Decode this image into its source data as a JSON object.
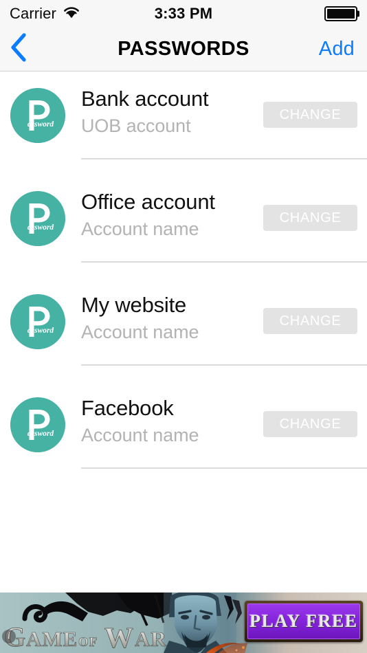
{
  "status_bar": {
    "carrier": "Carrier",
    "wifi_icon": "wifi-icon",
    "time": "3:33 PM",
    "battery_icon": "battery-full-icon"
  },
  "nav_bar": {
    "back_icon": "chevron-left-icon",
    "title": "PASSWORDS",
    "add_label": "Add",
    "accent_color": "#0a7cff",
    "background_color": "#f7f7f7"
  },
  "list": {
    "avatar_icon": "password-logo-icon",
    "avatar_color": "#45b2a4",
    "avatar_letter": "P",
    "avatar_word": "assword",
    "change_button_color": "#e3e3e3",
    "rows": [
      {
        "title": "Bank account",
        "subtitle": "UOB account",
        "change_label": "CHANGE"
      },
      {
        "title": "Office account",
        "subtitle": "Account name",
        "change_label": "CHANGE"
      },
      {
        "title": "My website",
        "subtitle": "Account name",
        "change_label": "CHANGE"
      },
      {
        "title": "Facebook",
        "subtitle": "Account name",
        "change_label": "CHANGE"
      }
    ]
  },
  "ad_banner": {
    "brand_line1": "GAME",
    "brand_of": "OF",
    "brand_line2": "WAR",
    "cta_label": "PLAY FREE",
    "info_badge": "i",
    "cta_color": "#8423dc",
    "background_color": "#9fb9bb"
  }
}
